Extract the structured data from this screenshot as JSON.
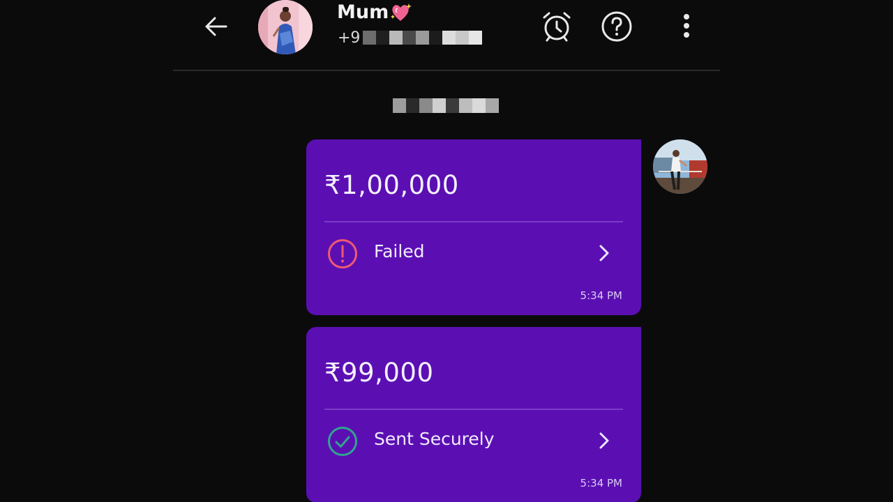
{
  "header": {
    "contact_name": "Mum",
    "phone_prefix": "+9",
    "icons": {
      "back": "arrow-left-icon",
      "alarm": "alarm-clock-icon",
      "help": "help-circle-icon",
      "more": "more-vertical-icon",
      "name_badge": "sparkling-heart-icon"
    }
  },
  "messages": [
    {
      "amount": "₹1,00,000",
      "status": "Failed",
      "status_icon": "alert-circle-icon",
      "status_color": "#ee5a72",
      "time": "5:34 PM"
    },
    {
      "amount": "₹99,000",
      "status": "Sent Securely",
      "status_icon": "check-circle-icon",
      "status_color": "#2fa58f",
      "time": "5:34 PM"
    }
  ],
  "colors": {
    "background": "#0b0b0c",
    "card": "#5b0fb3",
    "divider": "#7a3cc6"
  }
}
